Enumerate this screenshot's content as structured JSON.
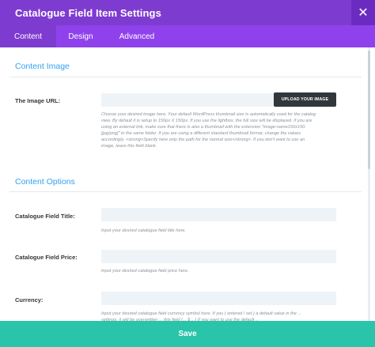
{
  "header": {
    "title": "Catalogue Field Item Settings"
  },
  "close_icon_glyph": "✕",
  "tabs": [
    {
      "label": "Content"
    },
    {
      "label": "Design"
    },
    {
      "label": "Advanced"
    }
  ],
  "sections": {
    "content_image": {
      "title": "Content Image",
      "image_url": {
        "label": "The Image URL:",
        "value": "",
        "upload_label": "UPLOAD YOUR IMAGE",
        "description": "Choose your desired image here. Your default WordPress thumbnail size is automatically used for the catalog view. By default it is setup to 150px X 150px. If you use the lightbox, the full size will be displayed. If you are using an external link, make sure that there is also a thumbnail with the extension \"image-name150x150.[jpg/png]\" in the same folder. If you are using a different standard thumbnail format, change the values accordingly. <strong>Specify here only the path for the normal size</strong>. If you don't want to use an image, leave this field blank."
      }
    },
    "content_options": {
      "title": "Content Options",
      "field_title": {
        "label": "Catalogue Field Title:",
        "value": "",
        "description": "Input your desired catalogue field title here."
      },
      "field_price": {
        "label": "Catalogue Field Price:",
        "value": "",
        "description": "Input your desired catalogue field price here."
      },
      "currency": {
        "label": "Currency:",
        "value": "",
        "description": "Input your desired catalogue field currency symbol here. If you ( entered / set ) a default value in the ... settings, it will be overwritten ... this field (... $ ...) If you want to use the default ..."
      }
    }
  },
  "footer": {
    "save_label": "Save"
  },
  "colors": {
    "header": "#7e3bd0",
    "tabs": "#8f42ec",
    "accent_blue": "#2ea3f2",
    "save": "#29c4a9"
  }
}
